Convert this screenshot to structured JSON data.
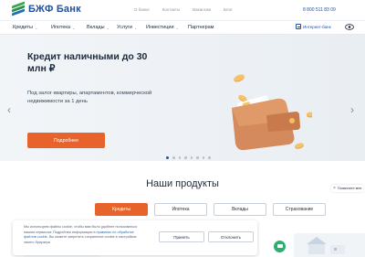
{
  "brand": {
    "name": "БЖФ Банк"
  },
  "topbar": {
    "links": [
      "О банке",
      "Контакты",
      "Вакансии",
      "Блог"
    ],
    "phone": "8 800 511 83 09"
  },
  "nav": {
    "items": [
      {
        "label": "Кредиты",
        "has_menu": true
      },
      {
        "label": "Ипотека",
        "has_menu": true
      },
      {
        "label": "Вклады",
        "has_menu": true
      },
      {
        "label": "Услуги",
        "has_menu": true
      },
      {
        "label": "Инвестиции",
        "has_menu": true
      },
      {
        "label": "Партнерам",
        "has_menu": false
      }
    ],
    "internet_bank": "Интернет-банк"
  },
  "hero": {
    "title": "Кредит наличными до 30 млн ₽",
    "subtitle": "Под залог квартиры, апартаментов, коммерческой недвижимости за 1 день",
    "button": "Подробнее",
    "slide_count": 8,
    "active_slide": 1
  },
  "products": {
    "title": "Наши продукты",
    "tabs": [
      "Кредиты",
      "Ипотека",
      "Вклады",
      "Страхование"
    ],
    "active_tab": 0
  },
  "cookie": {
    "text_before": "Мы используем файлы cookie, чтобы вам было удобнее пользоваться нашим сервисом. Подробная информация в ",
    "link_text": "правилах по обработке файлов cookie",
    "text_after": ". Вы можете запретить сохранение cookie в настройках своего браузера",
    "accept": "Принять",
    "decline": "Отклонить"
  },
  "recall": {
    "label": "Позвоните мне"
  },
  "colors": {
    "accent": "#e8622b",
    "brand": "#1f4f9e",
    "green": "#3aa655"
  }
}
